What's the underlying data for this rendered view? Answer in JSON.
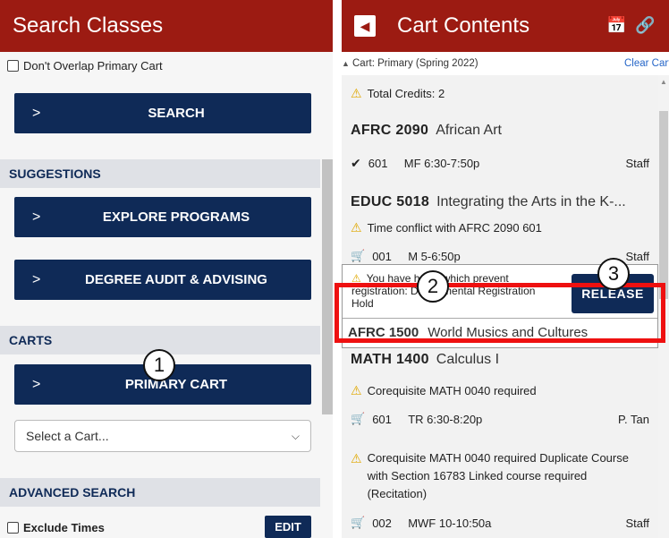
{
  "left": {
    "title": "Search Classes",
    "overlap_label": "Don't Overlap Primary Cart",
    "search_label": "SEARCH",
    "suggestions_header": "SUGGESTIONS",
    "explore_label": "EXPLORE PROGRAMS",
    "audit_label": "DEGREE AUDIT & ADVISING",
    "carts_header": "CARTS",
    "primary_cart_label": "PRIMARY CART",
    "cart_select_value": "Select a Cart...",
    "advanced_header": "ADVANCED SEARCH",
    "exclude_times_label": "Exclude Times",
    "edit_label": "EDIT",
    "chevron": ">"
  },
  "right": {
    "title": "Cart Contents",
    "cart_name": "Cart: Primary (Spring 2022)",
    "clear_label": "Clear Cart",
    "total_credits": "Total Credits: 2",
    "courses": [
      {
        "code": "AFRC 2090",
        "name": "African Art",
        "section": "601",
        "time": "MF 6:30-7:50p",
        "instructor": "Staff"
      },
      {
        "code": "EDUC 5018",
        "name": "Integrating the Arts in the K-...",
        "warning": "Time conflict with AFRC 2090 601",
        "section": "001",
        "time": "M 5-6:50p",
        "instructor": "Staff"
      },
      {
        "code": "AFRC 1500",
        "name": "World Musics and Cultures",
        "hold_text": "You have holds which prevent registration: Departmental Registration Hold",
        "release_label": "RELEASE"
      },
      {
        "code": "MATH 1400",
        "name": "Calculus I",
        "warning": "Corequisite MATH 0040 required",
        "section": "601",
        "time": "TR 6:30-8:20p",
        "instructor": "P. Tan",
        "warning2": "Corequisite MATH 0040 required Duplicate Course with Section 16783 Linked course required (Recitation)",
        "section2": "002",
        "time2": "MWF 10-10:50a",
        "instructor2": "Staff"
      }
    ]
  },
  "annotations": {
    "m1": "1",
    "m2": "2",
    "m3": "3"
  },
  "colors": {
    "header_red": "#9c1b12",
    "navy": "#0f2a57",
    "highlight_red": "#ee1010",
    "warning_yellow": "#e0a800",
    "link_blue": "#2566c8"
  }
}
